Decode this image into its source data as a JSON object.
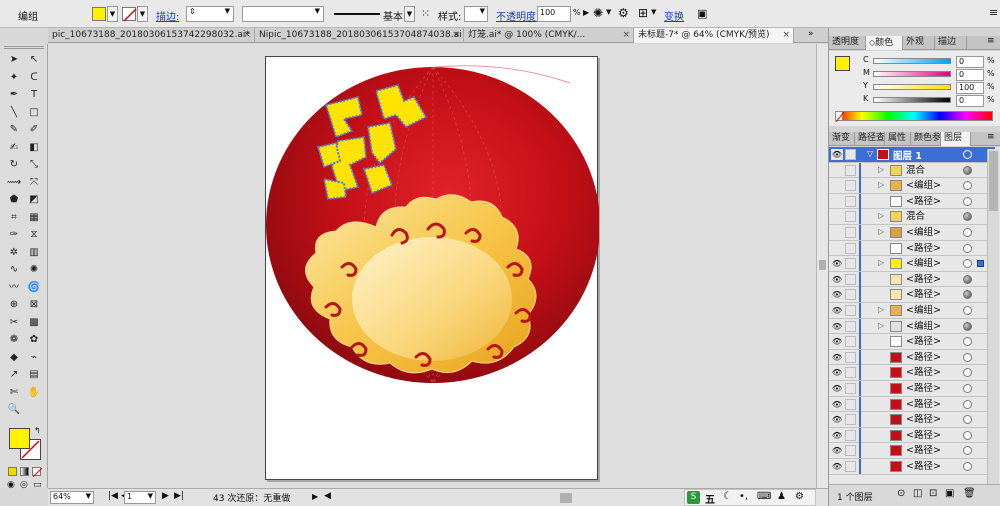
{
  "control_bar": {
    "selection": "编组",
    "stroke_label": "描边:",
    "stroke_style": "基本",
    "style_label": "样式:",
    "opacity_label": "不透明度:",
    "opacity_value": "100",
    "opacity_unit": "%",
    "transform_label": "变换",
    "fill_color": "#fff200"
  },
  "doc_tabs": [
    {
      "label": "pic_10673188_20180306153742298032.ai*",
      "close": "×"
    },
    {
      "label": "Nipic_10673188_20180306153704874038.ai",
      "close": "×"
    },
    {
      "label": "灯笼.ai* @ 100% (CMYK/...",
      "close": "×"
    },
    {
      "label": "未标题-7* @ 64% (CMYK/预览)",
      "close": "×"
    }
  ],
  "tools": {
    "icons": [
      "selection-tool-icon",
      "direct-selection-tool-icon",
      "magic-wand-icon",
      "lasso-icon",
      "pen-tool-icon",
      "type-tool-icon",
      "line-tool-icon",
      "rectangle-tool-icon",
      "paintbrush-icon",
      "pencil-icon",
      "blob-brush-icon",
      "eraser-icon",
      "rotate-tool-icon",
      "scale-tool-icon",
      "width-tool-icon",
      "free-transform-icon",
      "shape-builder-icon",
      "perspective-icon",
      "mesh-tool-icon",
      "gradient-tool-icon",
      "eyedropper-icon",
      "blend-tool-icon",
      "symbol-sprayer-icon",
      "column-graph-icon",
      "curvature-icon",
      "pucker-icon",
      "warp-icon",
      "twirl-icon",
      "crosshair-icon",
      "artboard-tool-icon",
      "slice-tool-icon",
      "mesh-icon",
      "bloat-icon",
      "scallop-icon",
      "crystallize-icon",
      "eyedropper2-icon",
      "measure-icon",
      "artboard2-icon",
      "knife-icon",
      "hand-tool-icon",
      "zoom-tool-icon"
    ],
    "fill_color": "#fff200",
    "stroke_color": "none"
  },
  "artwork": {
    "lantern_color": "#c40f16",
    "cloud_color": "#f7c548",
    "character_color": "#ffe400",
    "character_outline": "#4a73e8"
  },
  "status_bar": {
    "zoom": "64%",
    "page": "1",
    "history": "43 次还原：无重做"
  },
  "ime": {
    "label": "五",
    "icons": [
      "moon-icon",
      "punctuation-icon",
      "keyboard-icon",
      "skin-icon",
      "settings-icon"
    ]
  },
  "color_panel": {
    "tabs": [
      "透明度",
      "颜色",
      "外观",
      "描边"
    ],
    "active_tab": "颜色",
    "swatch": "#fff200",
    "channels": [
      {
        "label": "C",
        "value": "0",
        "color": "#00a0e9"
      },
      {
        "label": "M",
        "value": "0",
        "color": "#e4007f"
      },
      {
        "label": "Y",
        "value": "100",
        "color": "#ffe100"
      },
      {
        "label": "K",
        "value": "0",
        "color": "#000000"
      }
    ]
  },
  "layers_panel": {
    "tabs": [
      "渐变",
      "路径查",
      "属性",
      "颜色参",
      "图层"
    ],
    "active_tab": "图层",
    "layer_name": "图层 1",
    "rows": [
      {
        "name": "混合",
        "target_filled": true,
        "eye": false
      },
      {
        "name": "<编组>",
        "target_filled": false,
        "eye": false
      },
      {
        "name": "<路径>",
        "target_filled": false,
        "eye": false
      },
      {
        "name": "混合",
        "target_filled": true,
        "eye": false
      },
      {
        "name": "<编组>",
        "target_filled": false,
        "eye": false
      },
      {
        "name": "<路径>",
        "target_filled": false,
        "eye": false
      },
      {
        "name": "<编组>",
        "target_filled": false,
        "eye": true,
        "selected": true
      },
      {
        "name": "<路径>",
        "target_filled": true,
        "eye": true
      },
      {
        "name": "<路径>",
        "target_filled": true,
        "eye": true
      },
      {
        "name": "<编组>",
        "target_filled": false,
        "eye": true
      },
      {
        "name": "<编组>",
        "target_filled": true,
        "eye": true
      },
      {
        "name": "<路径>",
        "target_filled": false,
        "eye": true
      },
      {
        "name": "<路径>",
        "target_filled": false,
        "eye": true
      },
      {
        "name": "<路径>",
        "target_filled": false,
        "eye": true
      },
      {
        "name": "<路径>",
        "target_filled": false,
        "eye": true
      },
      {
        "name": "<路径>",
        "target_filled": false,
        "eye": true
      },
      {
        "name": "<路径>",
        "target_filled": false,
        "eye": true
      },
      {
        "name": "<路径>",
        "target_filled": false,
        "eye": true
      },
      {
        "name": "<路径>",
        "target_filled": false,
        "eye": true
      },
      {
        "name": "<路径>",
        "target_filled": false,
        "eye": true
      }
    ],
    "footer": "1 个图层"
  }
}
